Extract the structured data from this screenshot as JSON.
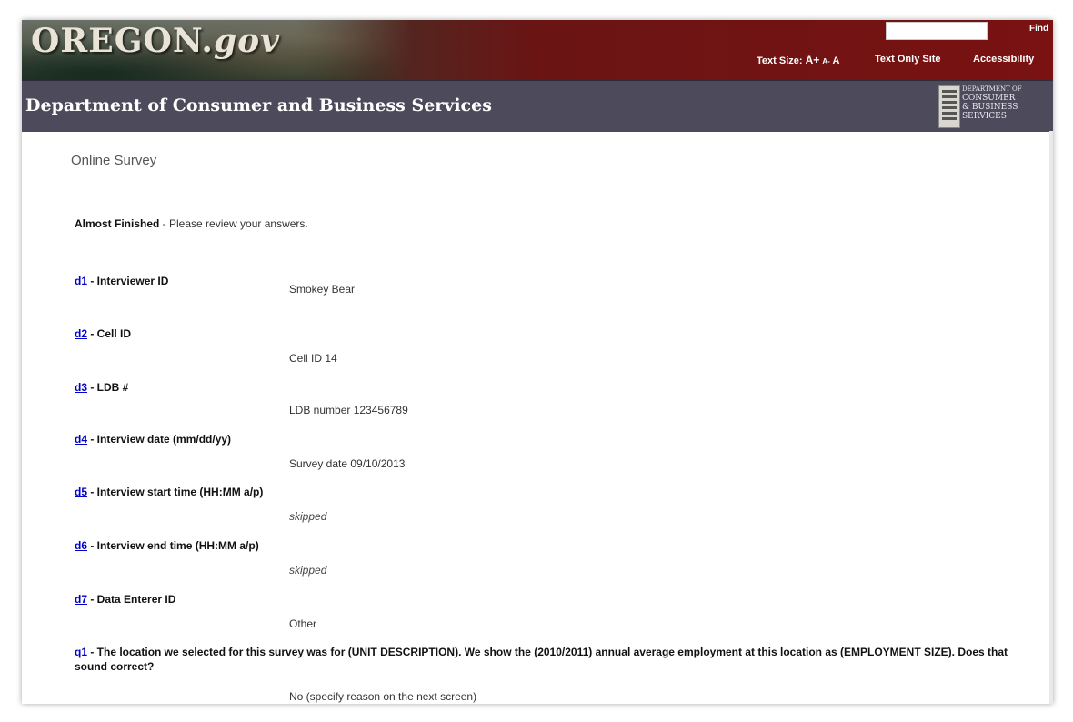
{
  "banner": {
    "logo_main": "OREGON.",
    "logo_gov": "gov",
    "find_label": "Find",
    "textsize_label": "Text Size:",
    "textsize_large": "A+",
    "textsize_small": "A-",
    "textsize_normal": "A",
    "text_only_label": "Text Only Site",
    "accessibility_label": "Accessibility"
  },
  "dept": {
    "title": "Department of Consumer and Business Services",
    "logo_line1": "Department of",
    "logo_line2": "Consumer",
    "logo_line3": "& Business",
    "logo_line4": "Services"
  },
  "page": {
    "title": "Online Survey",
    "status_bold": "Almost Finished",
    "status_rest": " - Please review your answers."
  },
  "questions": [
    {
      "id": "d1",
      "label": " - Interviewer ID",
      "answer": "Smokey Bear",
      "skipped": false
    },
    {
      "id": "d2",
      "label": " - Cell ID",
      "answer": "Cell ID 14",
      "skipped": false
    },
    {
      "id": "d3",
      "label": " - LDB #",
      "answer": "LDB number 123456789",
      "skipped": false
    },
    {
      "id": "d4",
      "label": " - Interview date (mm/dd/yy)",
      "answer": "Survey date 09/10/2013",
      "skipped": false
    },
    {
      "id": "d5",
      "label": " - Interview start time (HH:MM a/p)",
      "answer": "skipped",
      "skipped": true
    },
    {
      "id": "d6",
      "label": " - Interview end time (HH:MM a/p)",
      "answer": "skipped",
      "skipped": true
    },
    {
      "id": "d7",
      "label": " - Data Enterer ID",
      "answer": "Other",
      "skipped": false
    },
    {
      "id": "q1",
      "label": " - The location we selected for this survey was for (UNIT DESCRIPTION). We show the (2010/2011) annual average employment at this location as (EMPLOYMENT SIZE). Does that sound correct?",
      "answer": "No (specify reason on the next screen)",
      "skipped": false
    }
  ],
  "colors": {
    "banner_red": "#7a1212",
    "dept_bar": "#4d4a5b",
    "link_blue": "#0000cc"
  }
}
